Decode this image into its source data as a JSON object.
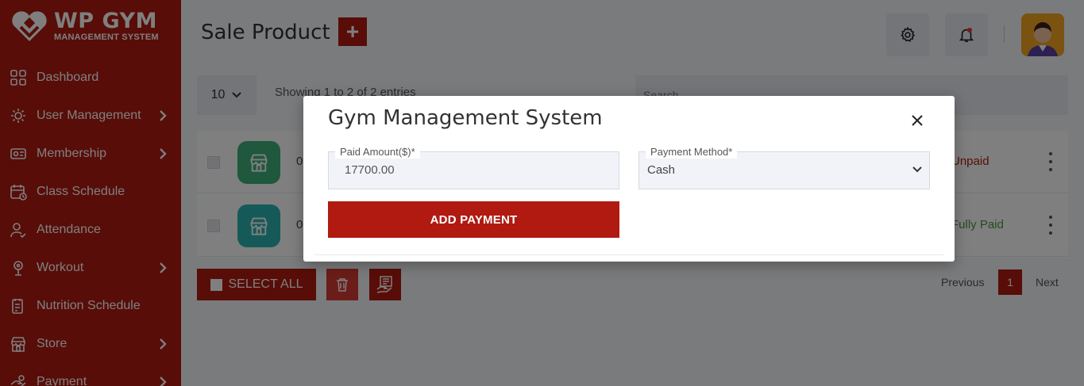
{
  "sidebar": {
    "logo_title": "WP GYM",
    "logo_sub": "MANAGEMENT SYSTEM",
    "items": [
      {
        "label": "Dashboard",
        "icon": "dashboard-grid-icon",
        "has_submenu": false
      },
      {
        "label": "User Management",
        "icon": "users-gear-icon",
        "has_submenu": true
      },
      {
        "label": "Membership",
        "icon": "membership-card-icon",
        "has_submenu": true
      },
      {
        "label": "Class Schedule",
        "icon": "calendar-icon",
        "has_submenu": false
      },
      {
        "label": "Attendance",
        "icon": "user-check-icon",
        "has_submenu": false
      },
      {
        "label": "Workout",
        "icon": "workout-icon",
        "has_submenu": true
      },
      {
        "label": "Nutrition Schedule",
        "icon": "nutrition-icon",
        "has_submenu": false
      },
      {
        "label": "Store",
        "icon": "store-icon",
        "has_submenu": true
      },
      {
        "label": "Payment",
        "icon": "payment-icon",
        "has_submenu": true
      }
    ]
  },
  "header": {
    "title": "Sale Product",
    "add_label": "+"
  },
  "table_controls": {
    "entries_value": "10",
    "showing_text": "Showing 1 to 2 of 2 entries",
    "search_placeholder": "Search"
  },
  "rows": [
    {
      "id_text": "0",
      "status": "Unpaid",
      "status_color": "#b01a10",
      "icon_color": "#3fb17a"
    },
    {
      "id_text": "0",
      "status": "Fully Paid",
      "status_color": "#4a9a3a",
      "icon_color": "#2bb5b0"
    }
  ],
  "footer": {
    "select_all_label": "SELECT ALL",
    "previous_label": "Previous",
    "page_number": "1",
    "next_label": "Next"
  },
  "modal": {
    "title": "Gym Management System",
    "paid_amount_label": "Paid Amount($)*",
    "paid_amount_value": "17700.00",
    "payment_method_label": "Payment Method*",
    "payment_method_value": "Cash",
    "submit_label": "ADD PAYMENT"
  },
  "colors": {
    "brand": "#b01a10",
    "sidebar_bg": "#b01a10"
  }
}
